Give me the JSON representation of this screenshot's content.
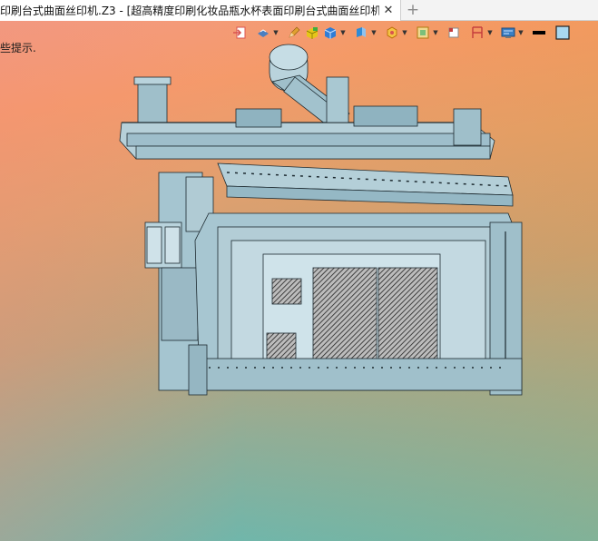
{
  "tab": {
    "title": "印刷台式曲面丝印机.Z3 - [超高精度印刷化妆品瓶水杯表面印刷台式曲面丝印机]",
    "close_glyph": "✕",
    "add_glyph": "+"
  },
  "hint_text": "些提示.",
  "toolbar": {
    "items": [
      {
        "icon": "exit-view-icon",
        "color": "#d9534f"
      },
      {
        "icon": "render-mode-icon",
        "color": "#4a7fc1"
      },
      {
        "icon": "pencil-icon",
        "color": "#e0a030"
      },
      {
        "icon": "shaded-box-icon",
        "color": "#e6c619"
      },
      {
        "icon": "cube-view-icon",
        "color": "#2f7dd6"
      },
      {
        "icon": "view-orient-icon",
        "color": "#2f8bd6"
      },
      {
        "icon": "section-view-icon",
        "color": "#f0a020"
      },
      {
        "icon": "frame-icon",
        "color": "#d9a32a"
      },
      {
        "icon": "fit-icon",
        "color": "#c43c3c"
      },
      {
        "icon": "dimension-icon",
        "color": "#c43c3c"
      },
      {
        "icon": "display-icon",
        "color": "#3a7fc4"
      },
      {
        "icon": "color-black-icon",
        "color": "#000000"
      },
      {
        "icon": "color-cyan-icon",
        "color": "#a9d8f0"
      }
    ]
  },
  "colors": {
    "machine_fill": "#a9c8d2",
    "machine_line": "#1d2a30",
    "hatch": "#2a2a2a"
  }
}
